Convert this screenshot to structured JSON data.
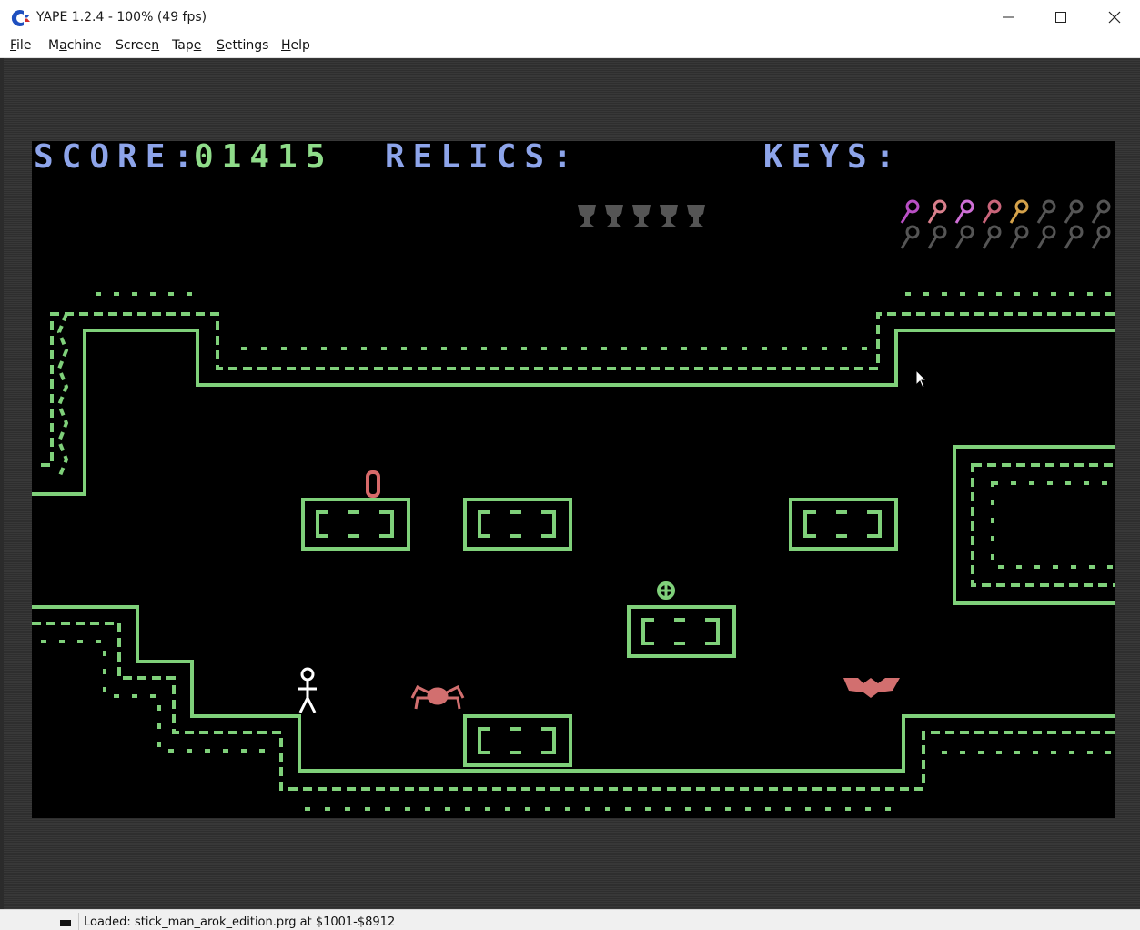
{
  "window": {
    "title": "YAPE 1.2.4 - 100% (49 fps)",
    "buttons": {
      "minimize": "─",
      "maximize": "☐",
      "close": "✕"
    }
  },
  "menu": {
    "items": [
      {
        "label": "File",
        "mnemonic": "F",
        "rest": "ile"
      },
      {
        "label": "Machine",
        "mnemonic": "a",
        "pre": "M",
        "rest": "chine"
      },
      {
        "label": "Screen",
        "mnemonic": "n",
        "pre": "Scree",
        "rest": ""
      },
      {
        "label": "Tape",
        "mnemonic": "e",
        "pre": "Tap",
        "rest": ""
      },
      {
        "label": "Settings",
        "mnemonic": "S",
        "pre": "",
        "rest": "ettings"
      },
      {
        "label": "Help",
        "mnemonic": "H",
        "pre": "",
        "rest": "elp"
      }
    ]
  },
  "game": {
    "score_label": "SCORE:",
    "score_value": "01415",
    "relics_label": "RELICS:",
    "relics_count": 5,
    "keys_label": "KEYS:",
    "keys_row1_colors": [
      "#b94fc4",
      "#d97f8c",
      "#cf6fd6",
      "#c9657a",
      "#d5a24a",
      "#555555",
      "#555555",
      "#555555"
    ],
    "keys_row2_colors": [
      "#555555",
      "#555555",
      "#555555",
      "#555555",
      "#555555",
      "#555555",
      "#555555",
      "#555555"
    ],
    "colors": {
      "wall": "#7fd07a",
      "hud_label": "#8da4ea",
      "score": "#8fdc8a",
      "relic": "#555555",
      "enemy": "#d26f6f",
      "player": "#ffffff",
      "item_red": "#d86a6a"
    }
  },
  "status": {
    "text": "Loaded: stick_man_arok_edition.prg at $1001-$8912"
  }
}
